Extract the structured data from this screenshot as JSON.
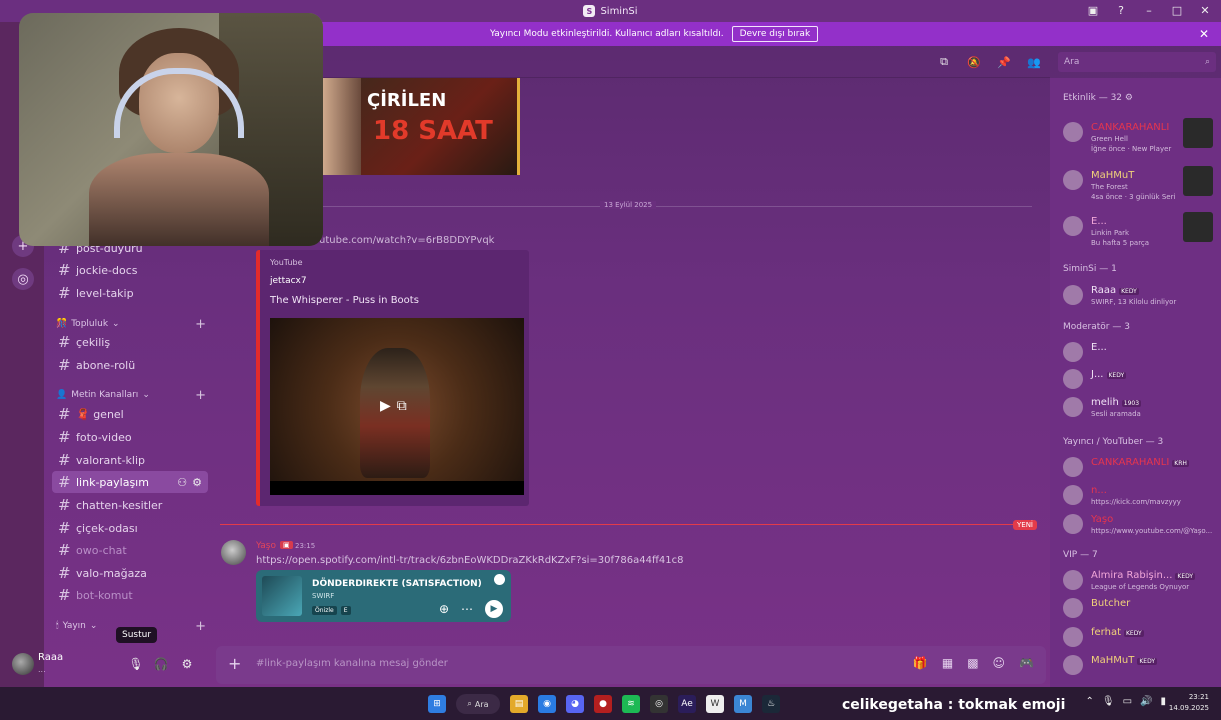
{
  "window": {
    "title": "SiminSi"
  },
  "banner": {
    "text": "Yayıncı Modu etkinleştirildi. Kullanıcı adları kısaltıldı.",
    "button": "Devre dışı bırak"
  },
  "search": {
    "placeholder": "Ara"
  },
  "thumbnail": {
    "line1": "ÇİRİLEN",
    "line2": "18 SAAT"
  },
  "date_divider": "13 Eylül 2025",
  "messages": {
    "yt_link": "youtube.com/watch?v=6rB8DDYPvqk",
    "embed": {
      "provider": "YouTube",
      "author": "jettacx7",
      "title": "The Whisperer - Puss in Boots"
    },
    "new_badge": "YENİ",
    "msg2": {
      "author": "Yaşo",
      "time": "23:15",
      "url": "https://open.spotify.com/intl-tr/track/6zbnEoWKDDraZKkRdKZxF?si=30f786a44ff41c8"
    },
    "spotify": {
      "track": "DÖNDERDIREKTE (SATISFACTION)",
      "artist": "SWIRF",
      "tag1": "Önizle",
      "tag2": "E"
    }
  },
  "channels": {
    "items": [
      {
        "label": "post-duyuru"
      },
      {
        "label": "jockie-docs"
      },
      {
        "label": "level-takip"
      },
      {
        "label": "çekiliş"
      },
      {
        "label": "abone-rolü"
      },
      {
        "label": "🧣 genel"
      },
      {
        "label": "foto-video"
      },
      {
        "label": "valorant-klip"
      },
      {
        "label": "link-paylaşım"
      },
      {
        "label": "chatten-kesitler"
      },
      {
        "label": "çiçek-odası"
      },
      {
        "label": "owo-chat"
      },
      {
        "label": "valo-mağaza"
      },
      {
        "label": "bot-komut"
      }
    ],
    "categories": {
      "topluluk": "Topluluk",
      "metin": "Metin Kanalları",
      "yayin": "Yayın"
    }
  },
  "user": {
    "name": "Raaa",
    "status": "...",
    "tooltip": "Sustur"
  },
  "composer": {
    "placeholder": "#link-paylaşım kanalına mesaj gönder"
  },
  "members": {
    "sections": {
      "activity": "Etkinlik — 32",
      "siminsi": "SiminSi — 1",
      "moderator": "Moderatör — 3",
      "yayinci": "Yayıncı / YouTuber — 3",
      "vip": "VIP — 7"
    },
    "activity": [
      {
        "name": "CANKARAHANLI",
        "game": "Green Hell",
        "sub": "İğne önce · New Player"
      },
      {
        "name": "MaHMuT",
        "game": "The Forest",
        "sub": "4sa önce · 3 günlük Seri"
      },
      {
        "name": "E...",
        "game": "Linkin Park",
        "sub": "Bu hafta 5 parça"
      }
    ],
    "siminsi": [
      {
        "name": "Raaa",
        "badge": "KEDY",
        "sub": "SWIRF, 13 Kilolu dinliyor"
      }
    ],
    "moderators": [
      {
        "name": "E...",
        "badge": "",
        "sub": ""
      },
      {
        "name": "J...",
        "badge": "KEDY",
        "sub": ""
      },
      {
        "name": "melih",
        "badge": "1903",
        "sub": "Sesli aramada"
      }
    ],
    "yayinci": [
      {
        "name": "CANKARAHANLI",
        "badge": "KRH",
        "sub": ""
      },
      {
        "name": "n...",
        "badge": "",
        "sub": "https://kick.com/mavzyyy"
      },
      {
        "name": "Yaşo",
        "badge": "",
        "sub": "https://www.youtube.com/@Yaşo..."
      }
    ],
    "vip": [
      {
        "name": "Almira Rabişin...",
        "badge": "KEDY",
        "sub": "League of Legends Oynuyor"
      },
      {
        "name": "Butcher",
        "badge": "",
        "sub": ""
      },
      {
        "name": "ferhat",
        "badge": "KEDY",
        "sub": ""
      },
      {
        "name": "MaHMuT",
        "badge": "KEDY",
        "sub": ""
      }
    ]
  },
  "taskbar": {
    "search": "Ara",
    "time": "23:21",
    "date": "14.09.2025"
  },
  "overlay_text": "celikegetaha : tokmak emoji"
}
